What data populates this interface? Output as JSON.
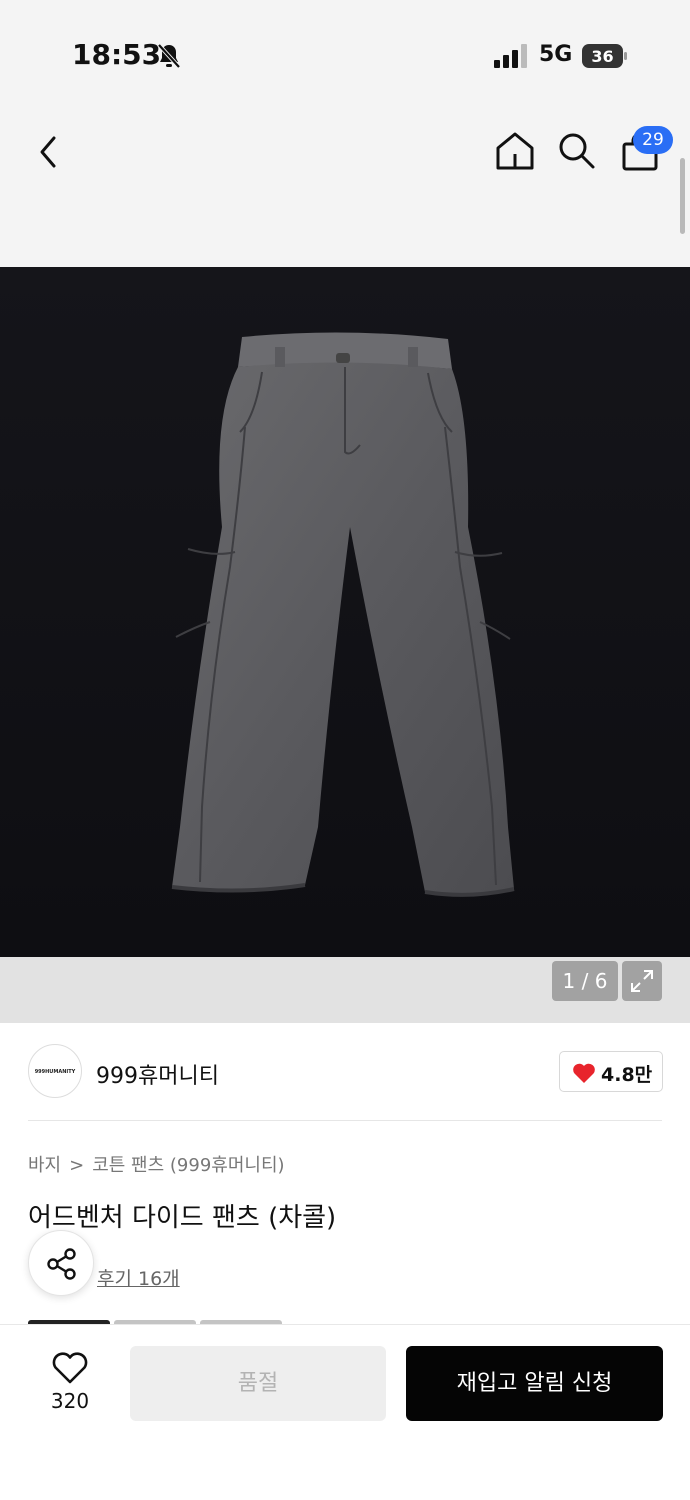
{
  "status_bar": {
    "time": "18:53",
    "network": "5G",
    "battery": "36"
  },
  "nav": {
    "cart_count": "29"
  },
  "gallery": {
    "counter": "1 / 6"
  },
  "brand": {
    "logo_text": "999HUMANITY",
    "name": "999휴머니티",
    "like_count": "4.8만"
  },
  "breadcrumb": {
    "category": "바지",
    "separator": ">",
    "subcategory": "코튼 팬츠 (999휴머니티)"
  },
  "product": {
    "title": "어드벤처 다이드 팬츠 (차콜)",
    "review_link": "후기 16개"
  },
  "bottom_bar": {
    "wish_count": "320",
    "soldout_label": "품절",
    "restock_label": "재입고 알림 신청"
  },
  "colors": {
    "accent_blue": "#2a6ef5",
    "heart_red": "#e8242c",
    "primary_black": "#050505"
  }
}
